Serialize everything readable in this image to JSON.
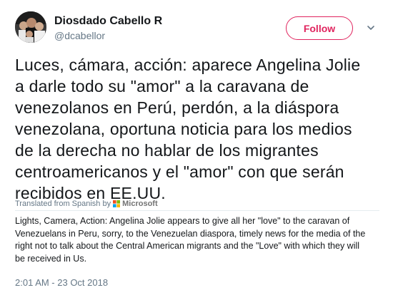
{
  "author": {
    "name": "Diosdado Cabello R",
    "handle": "@dcabellor"
  },
  "follow_label": "Follow",
  "tweet_text": "Luces, cámara, acción: aparece Angelina Jolie\na darle todo su \"amor\" a la caravana de\nvenezolanos en Perú, perdón, a la diáspora\nvenezolana, oportuna noticia para los medios\nde la derecha no hablar de los migrantes\ncentroamericanos y el \"amor\" con que serán\nrecibidos en EE.UU.",
  "translation": {
    "label": "Translated from Spanish by",
    "provider": "Microsoft",
    "text": "Lights, Camera, Action: Angelina Jolie appears to give all her \"love\" to the caravan of\nVenezuelans in Peru, sorry, to the Venezuelan diaspora, timely news for the media of the\nright not to talk about the Central American migrants and the \"Love\" with which they will\nbe received in Us."
  },
  "timestamp": "2:01 AM - 23 Oct 2018",
  "colors": {
    "follow_accent": "#e0245e",
    "secondary_text": "#657786",
    "primary_text": "#14171a"
  },
  "icons": {
    "menu": "chevron-down-icon",
    "translator": "microsoft-logo-icon"
  }
}
